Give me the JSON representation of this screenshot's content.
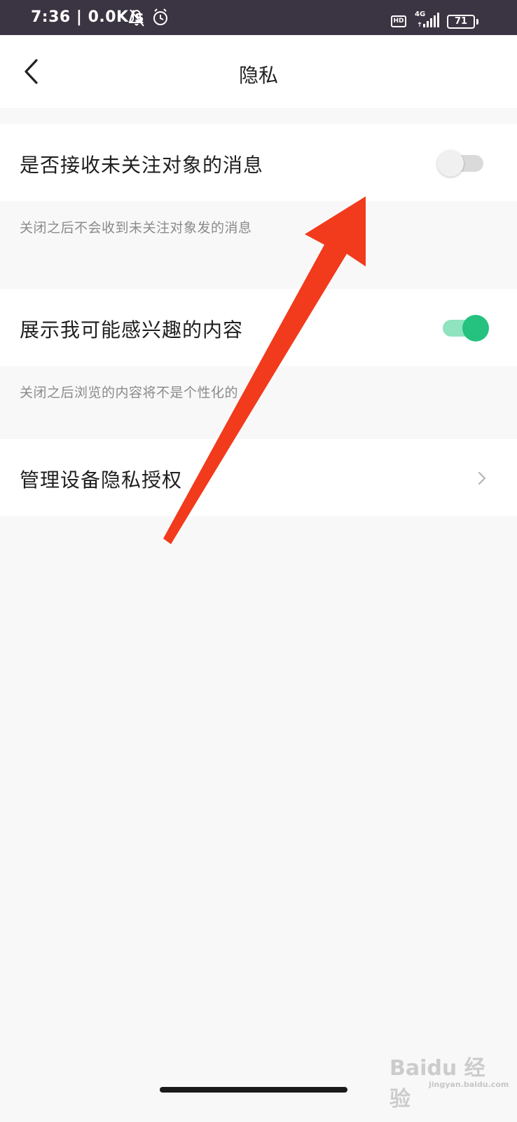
{
  "status_bar": {
    "time": "7:36 | 0.0K/s",
    "network": "4G",
    "hd_badge": "HD",
    "battery": "71",
    "icons": [
      "mute-notification-icon",
      "alarm-icon",
      "signal-icon",
      "battery-icon"
    ]
  },
  "header": {
    "title": "隐私",
    "back_icon": "back-chevron-icon"
  },
  "settings": [
    {
      "label": "是否接收未关注对象的消息",
      "description": "关闭之后不会收到未关注对象发的消息",
      "control": "toggle",
      "enabled": false
    },
    {
      "label": "展示我可能感兴趣的内容",
      "description": "关闭之后浏览的内容将不是个性化的",
      "control": "toggle",
      "enabled": true
    },
    {
      "label": "管理设备隐私授权",
      "control": "link",
      "icon": "chevron-right-icon"
    }
  ],
  "annotation": {
    "type": "arrow",
    "color": "#f23a1c"
  },
  "watermark": {
    "brand": "Baidu 经验",
    "url": "jingyan.baidu.com"
  },
  "colors": {
    "toggle_on": "#25c17f",
    "toggle_off": "#dadada",
    "status_bar": "#3b3442"
  }
}
